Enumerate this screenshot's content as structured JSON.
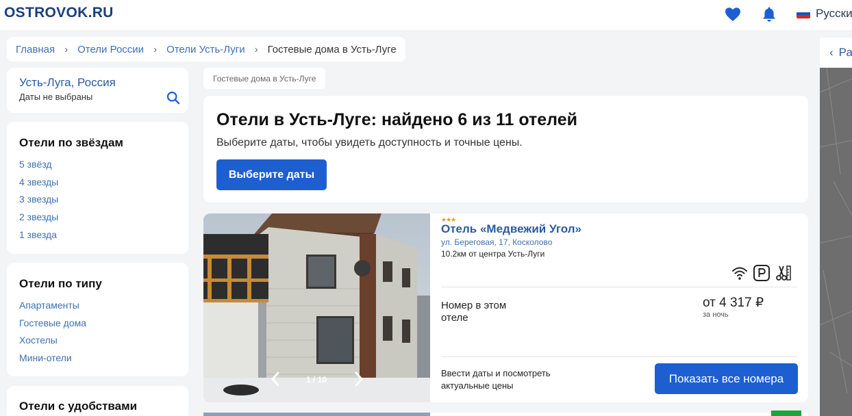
{
  "header": {
    "logo": "OSTROVOK.RU",
    "language": "Русский",
    "favorites_icon": "heart-icon",
    "notifications_icon": "bell-icon",
    "flag": "ru-flag",
    "colors": {
      "logo": "#1b3f7a",
      "icons": "#1d5fd0"
    }
  },
  "breadcrumb": {
    "items": [
      "Главная",
      "Отели России",
      "Отели Усть-Луги",
      "Гостевые дома в Усть-Луге"
    ]
  },
  "search": {
    "city": "Усть-Луга, Россия",
    "dates": "Даты не выбраны",
    "icon": "search-icon"
  },
  "filters": [
    {
      "title": "Отели по звёздам",
      "items": [
        "5 звёзд",
        "4 звезды",
        "3 звезды",
        "2 звезды",
        "1 звезда"
      ]
    },
    {
      "title": "Отели по типу",
      "items": [
        "Апартаменты",
        "Гостевые дома",
        "Хостелы",
        "Мини-отели"
      ]
    },
    {
      "title": "Отели с удобствами",
      "items": []
    }
  ],
  "main": {
    "tag": "Гостевые дома в Усть-Луге",
    "results_title": "Отели в Усть-Луге: найдено 6 из 11 отелей",
    "results_subtitle": "Выберите даты, чтобы увидеть доступность и точные цены.",
    "choose_dates_button": "Выберите даты",
    "accent_color": "#1d5fd0"
  },
  "hotel": {
    "stars": 3,
    "stars_text": "★★★",
    "name": "Отель «Медвежий Угол»",
    "address": "ул. Береговая, 17, Косколово",
    "distance": "10.2км от центра Усть-Луги",
    "amenities": [
      "wifi-icon",
      "parking-icon",
      "hairdresser-icon"
    ],
    "room_label": "Номер в этом отеле",
    "price": "от 4 317 ₽",
    "price_unit": "за ночь",
    "dates_hint": "Ввести даты и посмотреть актуальные цены",
    "show_rooms_button": "Показать все номера",
    "photo_counter": "1 / 10",
    "photo_index": 1,
    "photo_total": 10
  },
  "map": {
    "back_label": "Ра",
    "back_icon": "chevron-left-icon"
  }
}
